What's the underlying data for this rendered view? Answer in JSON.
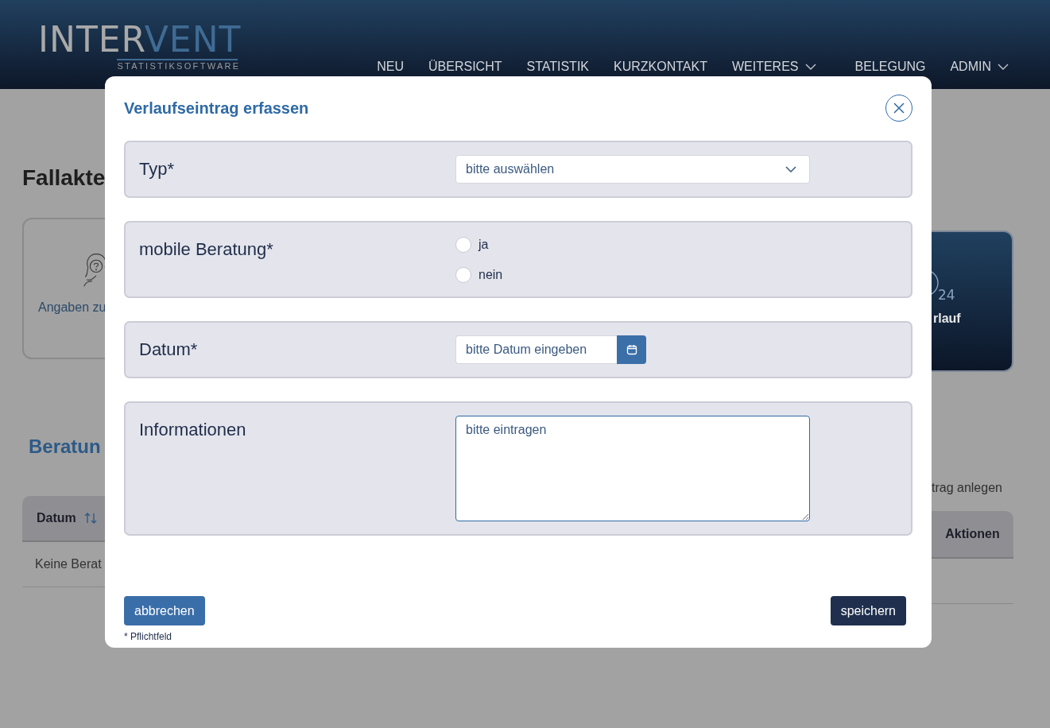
{
  "header": {
    "logo": {
      "part_1": "INTER",
      "part_2": "VENT",
      "tagline": "STATISTIKSOFTWARE"
    },
    "nav": [
      {
        "label": "NEU",
        "dropdown": false
      },
      {
        "label": "ÜBERSICHT",
        "dropdown": false
      },
      {
        "label": "STATISTIK",
        "dropdown": false
      },
      {
        "label": "KURZKONTAKT",
        "dropdown": false
      },
      {
        "label": "WEITERES",
        "dropdown": true
      },
      {
        "label": "BELEGUNG",
        "dropdown": false
      },
      {
        "label": "ADMIN",
        "dropdown": true
      }
    ]
  },
  "page": {
    "title": "Fallakte",
    "cards": [
      {
        "label": "Angaben zu",
        "kind": "light"
      },
      {
        "label": "rlauf",
        "kind": "dark",
        "icon_text": "24"
      }
    ],
    "section_title": "Beratun",
    "action_link": "trag anlegen",
    "table": {
      "columns": [
        {
          "label": "Datum",
          "sortable": true
        },
        {
          "label": "Aktionen",
          "sortable": false
        }
      ],
      "empty_text": "Keine Berat"
    }
  },
  "dialog": {
    "title": "Verlaufseintrag erfassen",
    "fields": [
      {
        "kind": "select",
        "label": "Typ*",
        "placeholder": "bitte auswählen"
      },
      {
        "kind": "radio",
        "label": "mobile Beratung*",
        "options": [
          {
            "label": "ja",
            "selected": false
          },
          {
            "label": "nein",
            "selected": false
          }
        ]
      },
      {
        "kind": "date",
        "label": "Datum*",
        "placeholder": "bitte Datum eingeben"
      },
      {
        "kind": "textarea",
        "label": "Informationen",
        "placeholder": "bitte eintragen"
      }
    ],
    "buttons": [
      {
        "label": "abbrechen",
        "kind": "secondary"
      },
      {
        "label": "speichern",
        "kind": "primary"
      }
    ],
    "note": "* Pflichtfeld"
  }
}
